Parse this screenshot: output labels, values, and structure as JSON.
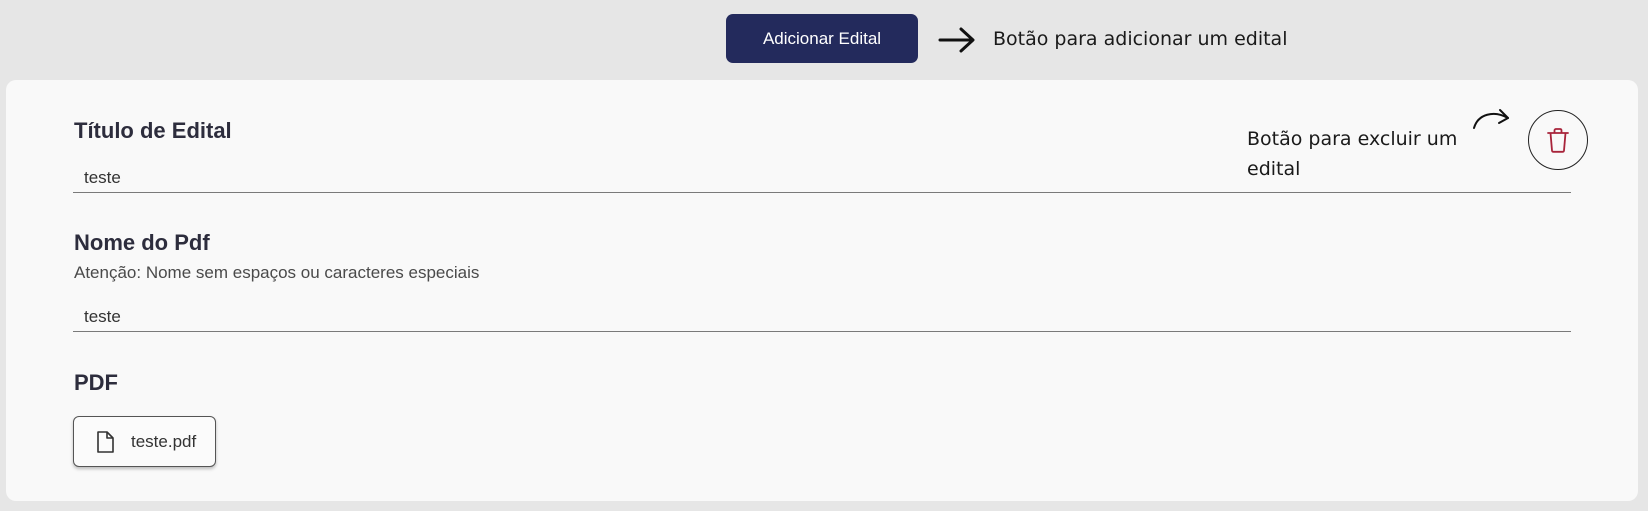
{
  "header": {
    "add_button_label": "Adicionar Edital",
    "add_annotation": "Botão para adicionar um edital"
  },
  "form": {
    "title_label": "Título de Edital",
    "title_value": "teste",
    "pdf_name_label": "Nome do Pdf",
    "pdf_name_hint": "Atenção: Nome sem espaços ou caracteres especiais",
    "pdf_name_value": "teste",
    "pdf_label": "PDF",
    "pdf_file_name": "teste.pdf"
  },
  "delete": {
    "annotation": "Botão para excluir um edital",
    "icon": "trash-icon",
    "icon_color": "#a8243b"
  },
  "colors": {
    "primary_button": "#232a5c",
    "page_background": "#e6e6e6",
    "card_background": "#f9f9f9"
  }
}
